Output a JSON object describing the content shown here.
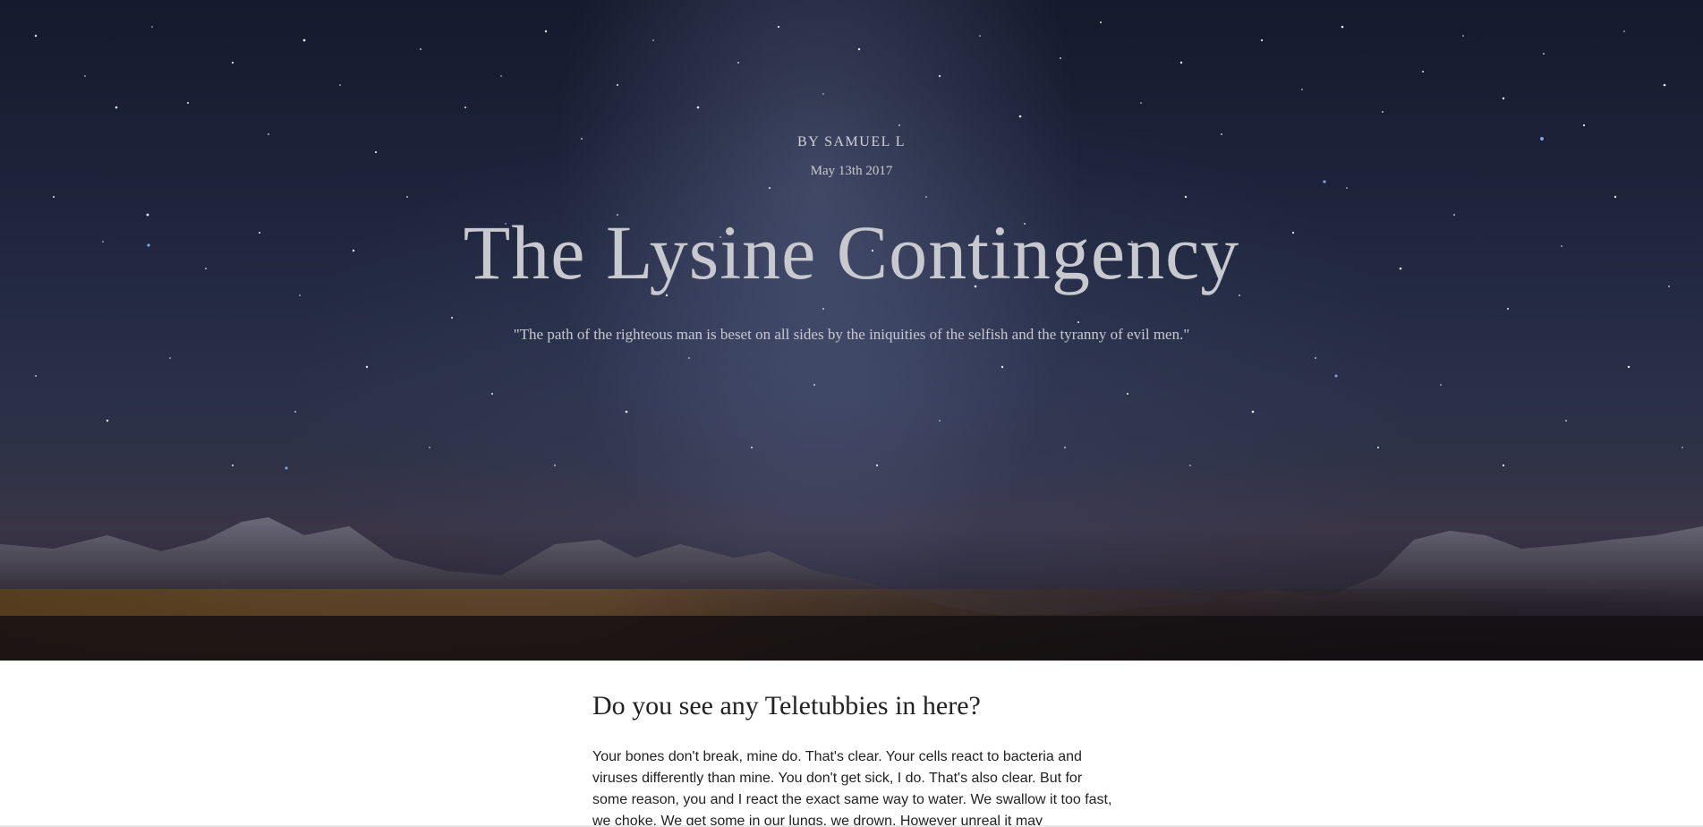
{
  "hero": {
    "byline": "BY SAMUEL L",
    "date": "May 13th 2017",
    "title": "The Lysine Contingency",
    "quote": "\"The path of the righteous man is beset on all sides by the iniquities of the selfish and the tyranny of evil men.\""
  },
  "article": {
    "heading": "Do you see any Teletubbies in here?",
    "paragraph": "Your bones don't break, mine do. That's clear. Your cells react to bacteria and viruses differently than mine. You don't get sick, I do. That's also clear. But for some reason, you and I react the exact same way to water. We swallow it too fast, we choke. We get some in our lungs, we drown. However unreal it may"
  },
  "colors": {
    "hero_text": "#d6d6d6",
    "body_text": "#222222",
    "background": "#ffffff"
  }
}
